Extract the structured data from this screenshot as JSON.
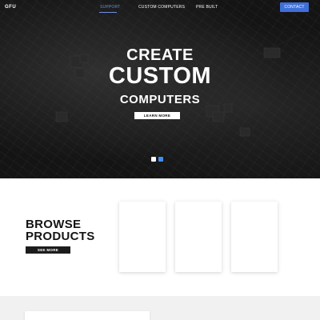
{
  "nav": {
    "logo": "GFU",
    "links": [
      {
        "label": "SUPPORT",
        "active": true
      },
      {
        "label": "CUSTOM COMPUTERS",
        "active": false
      },
      {
        "label": "PRE BUILT",
        "active": false
      }
    ],
    "contact_label": "CONTACT"
  },
  "hero": {
    "line1": "CREATE",
    "line2": "CUSTOM",
    "line3": "COMPUTERS",
    "cta_label": "LEARN MORE",
    "slides": {
      "count": 2,
      "active": 2
    }
  },
  "browse": {
    "title": "BROWSE PRODUCTS",
    "see_more_label": "SEE MORE"
  },
  "colors": {
    "accent": "#3f70d8",
    "active_link": "#6f8fe0",
    "hero_bg": "#141414",
    "dark": "#1c1c1c"
  }
}
